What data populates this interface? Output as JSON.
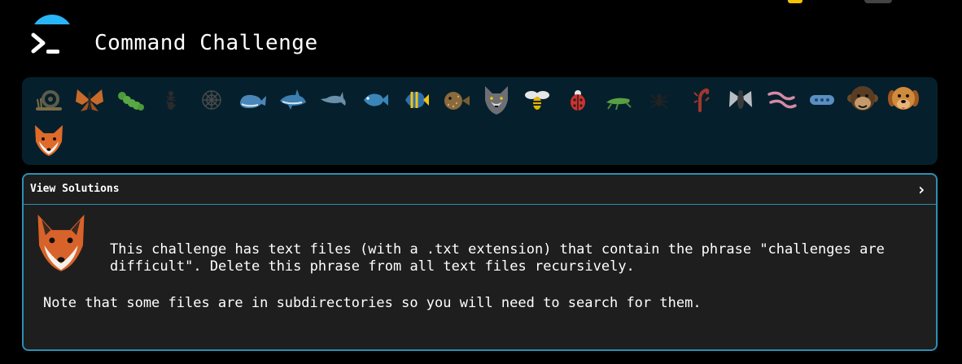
{
  "header": {
    "title": "Command Challenge",
    "logo_icon": "terminal-prompt-icon",
    "accent_color": "#29b6f6"
  },
  "icon_bar": {
    "icons": [
      "snail-icon",
      "butterfly-icon",
      "caterpillar-icon",
      "ant-icon",
      "spider-web-icon",
      "whale-icon",
      "shark-icon",
      "dolphin-icon",
      "fish-icon",
      "tropical-fish-icon",
      "blowfish-icon",
      "wolf-icon",
      "bee-icon",
      "ladybug-icon",
      "cricket-icon",
      "spider-icon",
      "scorpion-icon",
      "fly-icon",
      "worm-icon",
      "microbe-icon",
      "monkey-icon",
      "dog-icon",
      "fox-icon"
    ]
  },
  "panel": {
    "toggle_label": "View Solutions",
    "toggle_icon": "chevron-right-icon",
    "avatar_icon": "fox-icon",
    "description": "This challenge has text files (with a .txt extension) that contain the phrase \"challenges are difficult\". Delete this phrase from all text files recursively.",
    "note": "Note that some files are in subdirectories so you will need to search for them.",
    "border_color": "#2b8fb3"
  }
}
